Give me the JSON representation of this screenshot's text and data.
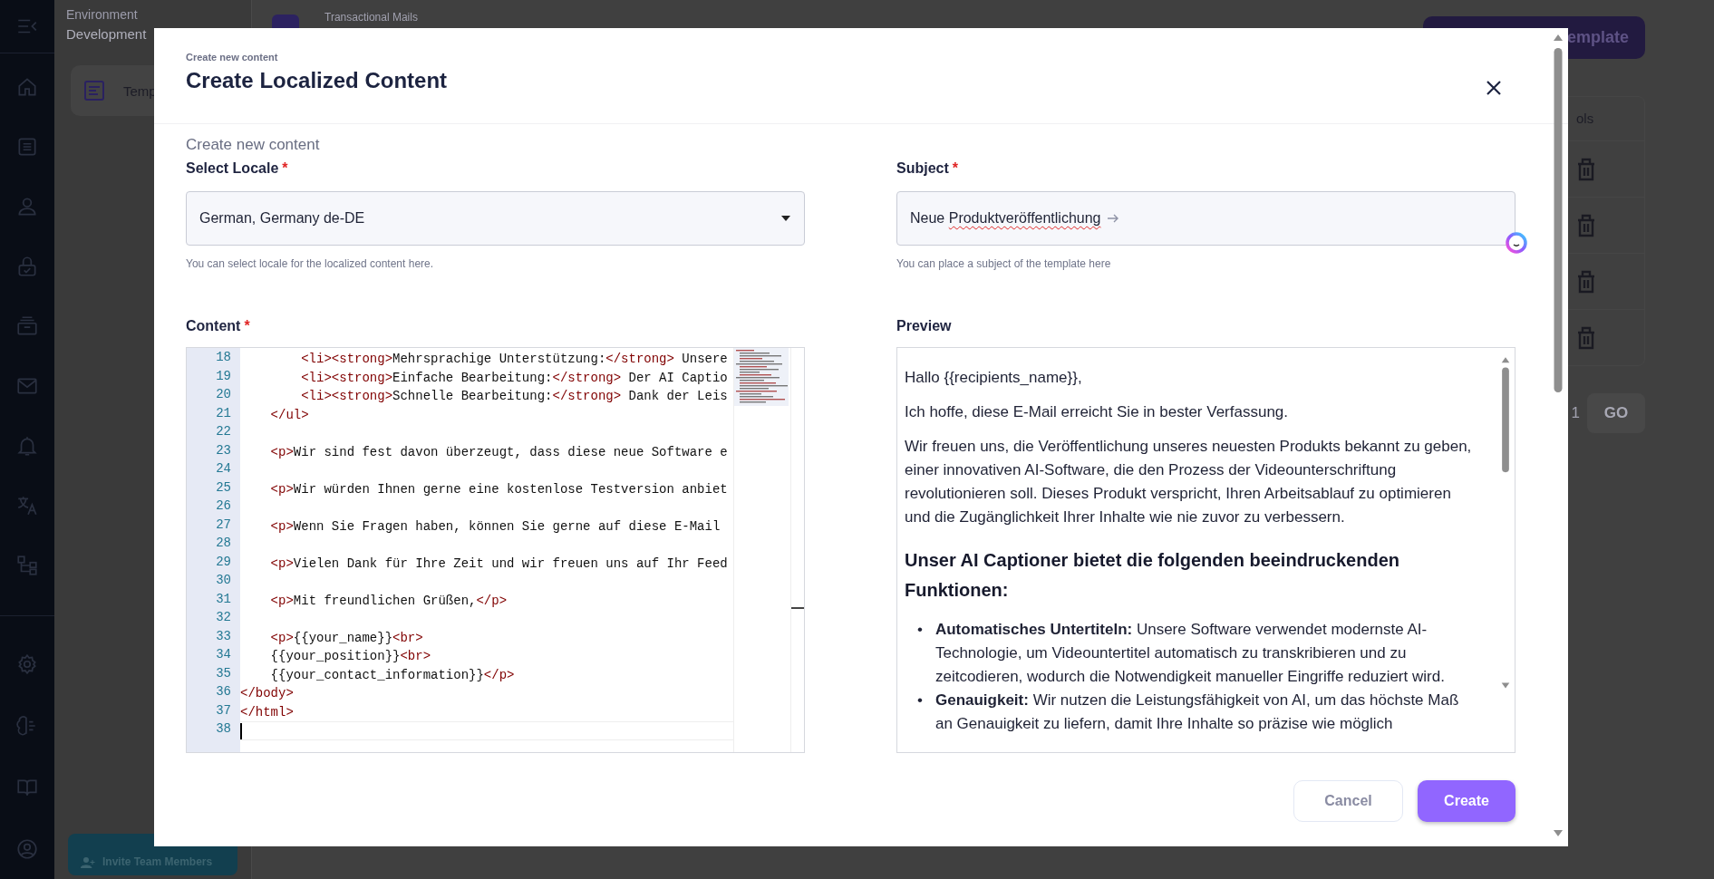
{
  "environment": {
    "label": "Environment",
    "value": "Development"
  },
  "template_card": {
    "label": "Temp"
  },
  "invite_button": {
    "label": "Invite Team Members"
  },
  "page": {
    "title": "Transactional Mails",
    "create_button": "emplate",
    "table_header": "ols",
    "page_number": "1",
    "go_button": "GO"
  },
  "modal": {
    "overline": "Create new content",
    "title": "Create Localized Content",
    "subtitle": "Create new content",
    "locale": {
      "label": "Select Locale",
      "required_mark": "*",
      "value": "German, Germany de-DE",
      "helper": "You can select locale for the localized content here."
    },
    "subject": {
      "label": "Subject",
      "required_mark": "*",
      "value_parts": [
        {
          "text": "Neue ",
          "misspelled": false
        },
        {
          "text": "Produktveröffentlichung",
          "misspelled": true
        }
      ],
      "helper": "You can place a subject of the template here"
    },
    "content": {
      "label": "Content",
      "required_mark": "*",
      "lines": [
        {
          "number": "18",
          "text": "        <li><strong>Mehrsprachige Unterstützung:</strong> Unsere"
        },
        {
          "number": "19",
          "text": "        <li><strong>Einfache Bearbeitung:</strong> Der AI Captio"
        },
        {
          "number": "20",
          "text": "        <li><strong>Schnelle Bearbeitung:</strong> Dank der Leis"
        },
        {
          "number": "21",
          "text": "    </ul>"
        },
        {
          "number": "22"
        },
        {
          "number": "23",
          "text": "    <p>Wir sind fest davon überzeugt, dass diese neue Software e"
        },
        {
          "number": "24"
        },
        {
          "number": "25",
          "text": "    <p>Wir würden Ihnen gerne eine kostenlose Testversion anbiet"
        },
        {
          "number": "26"
        },
        {
          "number": "27",
          "text": "    <p>Wenn Sie Fragen haben, können Sie gerne auf diese E-Mail"
        },
        {
          "number": "28"
        },
        {
          "number": "29",
          "text": "    <p>Vielen Dank für Ihre Zeit und wir freuen uns auf Ihr Feed"
        },
        {
          "number": "30"
        },
        {
          "number": "31",
          "text": "    <p>Mit freundlichen Grüßen,</p>"
        },
        {
          "number": "32"
        },
        {
          "number": "33",
          "text": "    <p>{{your_name}}<br>"
        },
        {
          "number": "34",
          "text": "    {{your_position}}<br>"
        },
        {
          "number": "35",
          "text": "    {{your_contact_information}}</p>"
        },
        {
          "number": "36",
          "text": "</body>"
        },
        {
          "number": "37",
          "text": "</html>"
        },
        {
          "number": "38"
        }
      ]
    },
    "preview": {
      "label": "Preview",
      "blocks": [
        {
          "kind": "paragraph",
          "text": "Hallo {{recipients_name}},"
        },
        {
          "kind": "paragraph",
          "text": "Ich hoffe, diese E-Mail erreicht Sie in bester Verfassung."
        },
        {
          "kind": "paragraph",
          "text": "Wir freuen uns, die Veröffentlichung unseres neuesten Produkts bekannt zu geben, einer innovativen AI-Software, die den Prozess der Videounterschriftung revolutionieren soll. Dieses Produkt verspricht, Ihren Arbeitsablauf zu optimieren und die Zugänglichkeit Ihrer Inhalte wie nie zuvor zu verbessern."
        },
        {
          "kind": "heading",
          "text": "Unser AI Captioner bietet die folgenden beeindruckenden Funktionen:"
        },
        {
          "kind": "list",
          "items": [
            {
              "marker": "•",
              "text": "**Automatisches Untertiteln:** Unsere Software verwendet modernste AI-Technologie, um Videountertitel automatisch zu transkribieren und zu zeitcodieren, wodurch die Notwendigkeit manueller Eingriffe reduziert wird."
            },
            {
              "marker": "•",
              "text": "**Genauigkeit:** Wir nutzen die Leistungsfähigkeit von AI, um das höchste Maß an Genauigkeit zu liefern, damit Ihre Inhalte so präzise wie möglich"
            }
          ]
        }
      ]
    },
    "buttons": [
      {
        "label": "Cancel",
        "kind": "secondary"
      },
      {
        "label": "Create",
        "kind": "primary"
      }
    ]
  }
}
